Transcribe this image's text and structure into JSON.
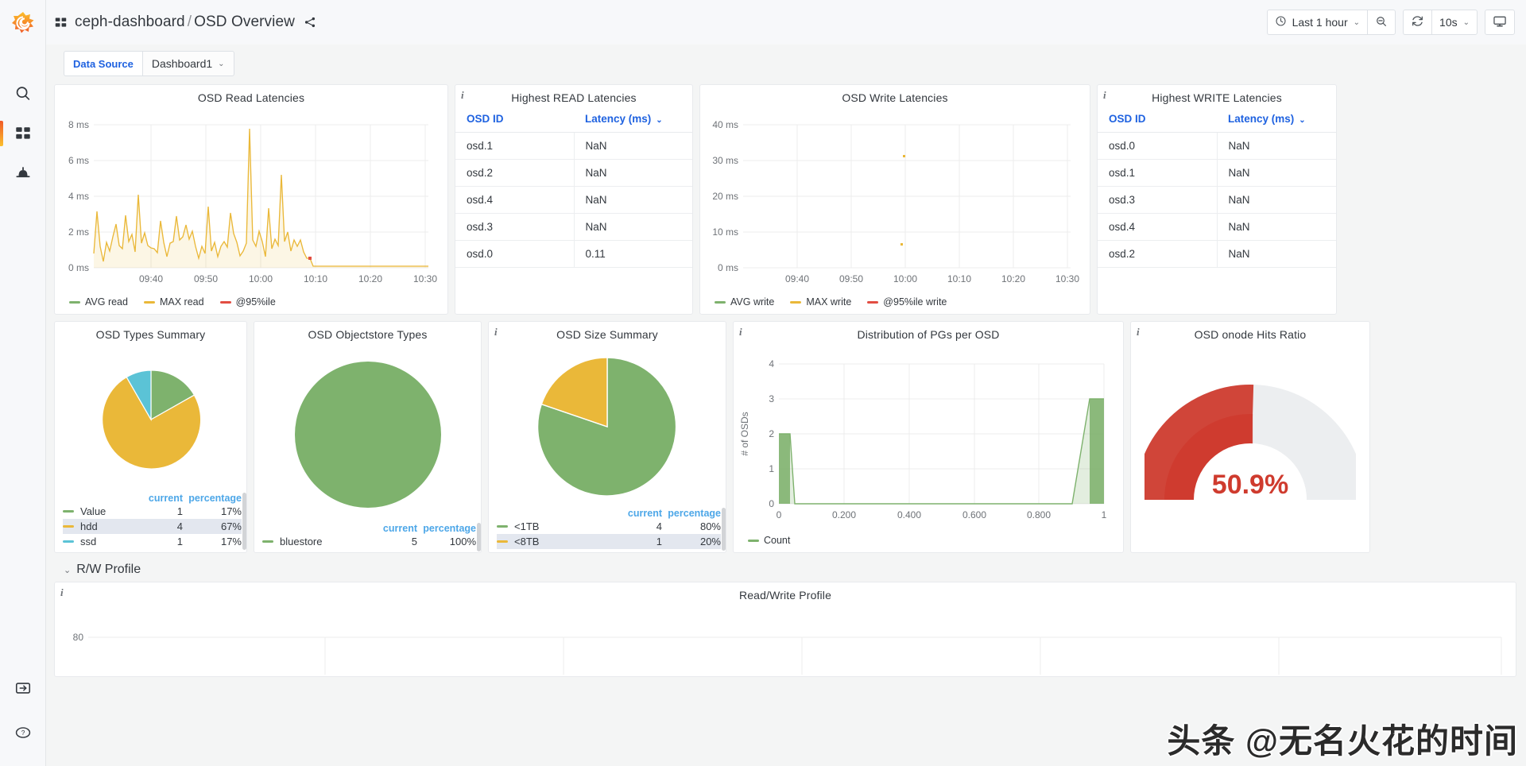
{
  "sidebar": {
    "logo": "grafana-logo",
    "items": [
      {
        "name": "search",
        "icon": "search-icon"
      },
      {
        "name": "dashboards",
        "icon": "dashboards-grid-icon",
        "active": true
      },
      {
        "name": "alerting",
        "icon": "bell-icon"
      }
    ],
    "bottom_items": [
      {
        "name": "sign-in",
        "icon": "sign-in-icon"
      },
      {
        "name": "help",
        "icon": "help-question-icon"
      }
    ]
  },
  "header": {
    "breadcrumb_root": "ceph-dashboard",
    "breadcrumb_sep": "/",
    "breadcrumb_current": "OSD Overview",
    "share_icon": "share-icon",
    "time_picker": {
      "icon": "clock-icon",
      "label": "Last 1 hour",
      "caret": "⌄"
    },
    "zoom_out": {
      "icon": "zoom-out-icon"
    },
    "refresh": {
      "icon": "refresh-icon"
    },
    "refresh_interval": {
      "label": "10s",
      "caret": "⌄"
    },
    "tv_mode": {
      "icon": "monitor-icon"
    }
  },
  "variables": {
    "datasource_label": "Data Source",
    "datasource_value": "Dashboard1",
    "caret": "⌄"
  },
  "colors": {
    "green": "#7eb26d",
    "yellow": "#eab839",
    "orange": "#e24d42",
    "cyan": "#5bc3d6",
    "blue_link": "#1f62e0",
    "legend_blue": "#4da7e8",
    "gauge_red": "#cf3b2e",
    "gauge_green": "#0fa21e",
    "gauge_track": "#eceef0"
  },
  "panels": {
    "osd_read_latencies": {
      "title": "OSD Read Latencies",
      "has_info": false,
      "legend": [
        {
          "label": "AVG read",
          "color": "#7eb26d"
        },
        {
          "label": "MAX read",
          "color": "#eab839"
        },
        {
          "label": "@95%ile",
          "color": "#e24d42"
        }
      ]
    },
    "highest_read_latencies": {
      "title": "Highest READ Latencies",
      "has_info": true,
      "columns": [
        "OSD ID",
        "Latency (ms)"
      ],
      "sort_caret": "⌄",
      "rows": [
        [
          "osd.1",
          "NaN"
        ],
        [
          "osd.2",
          "NaN"
        ],
        [
          "osd.4",
          "NaN"
        ],
        [
          "osd.3",
          "NaN"
        ],
        [
          "osd.0",
          "0.11"
        ]
      ]
    },
    "osd_write_latencies": {
      "title": "OSD Write Latencies",
      "has_info": false,
      "legend": [
        {
          "label": "AVG write",
          "color": "#7eb26d"
        },
        {
          "label": "MAX write",
          "color": "#eab839"
        },
        {
          "label": "@95%ile write",
          "color": "#e24d42"
        }
      ]
    },
    "highest_write_latencies": {
      "title": "Highest WRITE Latencies",
      "has_info": true,
      "columns": [
        "OSD ID",
        "Latency (ms)"
      ],
      "sort_caret": "⌄",
      "rows": [
        [
          "osd.0",
          "NaN"
        ],
        [
          "osd.1",
          "NaN"
        ],
        [
          "osd.3",
          "NaN"
        ],
        [
          "osd.4",
          "NaN"
        ],
        [
          "osd.2",
          "NaN"
        ]
      ]
    },
    "osd_types_summary": {
      "title": "OSD Types Summary",
      "has_info": false,
      "legend_headers": [
        "current",
        "percentage"
      ],
      "legend": [
        {
          "label": "Value",
          "color": "#7eb26d",
          "current": "1",
          "percentage": "17%",
          "highlight": false
        },
        {
          "label": "hdd",
          "color": "#eab839",
          "current": "4",
          "percentage": "67%",
          "highlight": true
        },
        {
          "label": "ssd",
          "color": "#5bc3d6",
          "current": "1",
          "percentage": "17%",
          "highlight": false
        }
      ]
    },
    "osd_objectstore_types": {
      "title": "OSD Objectstore Types",
      "has_info": false,
      "legend_headers": [
        "current",
        "percentage"
      ],
      "legend": [
        {
          "label": "bluestore",
          "color": "#7eb26d",
          "current": "5",
          "percentage": "100%",
          "highlight": false
        }
      ]
    },
    "osd_size_summary": {
      "title": "OSD Size Summary",
      "has_info": true,
      "legend_headers": [
        "current",
        "percentage"
      ],
      "legend": [
        {
          "label": "<1TB",
          "color": "#7eb26d",
          "current": "4",
          "percentage": "80%",
          "highlight": false
        },
        {
          "label": "<8TB",
          "color": "#eab839",
          "current": "1",
          "percentage": "20%",
          "highlight": true
        }
      ]
    },
    "distribution_pgs_per_osd": {
      "title": "Distribution of PGs per OSD",
      "has_info": true,
      "legend": [
        {
          "label": "Count",
          "color": "#7eb26d"
        }
      ]
    },
    "osd_onode_hits_ratio": {
      "title": "OSD onode Hits Ratio",
      "has_info": true,
      "value": "50.9%"
    },
    "rw_profile_section": {
      "title": "R/W Profile",
      "caret": "⌄"
    },
    "read_write_profile": {
      "title": "Read/Write Profile",
      "has_info": true,
      "y_tick": "80"
    }
  },
  "watermark": "头条 @无名火花的时间",
  "chart_data": [
    {
      "type": "line",
      "title": "OSD Read Latencies",
      "xlabel": "",
      "ylabel": "",
      "ylim": [
        0,
        8.8
      ],
      "yticks": [
        "0 ms",
        "2 ms",
        "4 ms",
        "6 ms",
        "8 ms"
      ],
      "ytickvals": [
        0,
        2,
        4,
        6,
        8
      ],
      "xticks": [
        "09:40",
        "09:50",
        "10:00",
        "10:10",
        "10:20",
        "10:30"
      ],
      "xtickvals": [
        0.175,
        0.355,
        0.535,
        0.715,
        0.89,
        1.0
      ],
      "grid": true,
      "legend_position": "bottom-left",
      "series": [
        {
          "name": "AVG read",
          "color": "#7eb26d",
          "values": []
        },
        {
          "name": "MAX read",
          "color": "#eab839",
          "values": [
            0.8,
            3.15,
            1.2,
            0.35,
            1.4,
            0.95,
            1.75,
            2.45,
            1.25,
            1.05,
            2.95,
            1.45,
            1.85,
            0.9,
            4.1,
            1.35,
            1.95,
            1.25,
            1.1,
            1.05,
            0.85,
            2.6,
            1.4,
            0.6,
            1.35,
            1.45,
            2.9,
            1.55,
            1.75,
            2.4,
            1.6,
            2.05,
            1.2,
            0.55,
            1.2,
            0.8,
            3.4,
            0.95,
            1.4,
            0.6,
            1.2,
            1.45,
            1.15,
            3.05,
            1.9,
            1.4,
            0.65,
            0.95,
            1.35,
            7.75,
            1.55,
            1.2,
            2.05,
            1.45,
            0.6,
            3.35,
            1.05,
            1.6,
            1.25,
            5.2,
            1.45,
            2.0,
            0.95,
            1.55,
            1.2,
            1.55,
            0.9,
            0.55,
            0.55,
            0.09,
            0.09,
            0.08,
            0.08,
            0.08,
            0.08,
            0.08,
            0.08,
            0.08,
            0.08,
            0.08,
            0.08,
            0.08,
            0.08,
            0.08,
            0.08,
            0.08,
            0.08,
            0.08,
            0.08,
            0.08
          ]
        },
        {
          "name": "@95%ile",
          "color": "#e24d42",
          "values": []
        }
      ]
    },
    {
      "type": "scatter",
      "title": "OSD Write Latencies",
      "xlabel": "",
      "ylabel": "",
      "ylim": [
        0,
        44
      ],
      "yticks": [
        "0 ms",
        "10 ms",
        "20 ms",
        "30 ms",
        "40 ms"
      ],
      "ytickvals": [
        0,
        10,
        20,
        30,
        40
      ],
      "xticks": [
        "09:40",
        "09:50",
        "10:00",
        "10:10",
        "10:20",
        "10:30"
      ],
      "xtickvals": [
        0.175,
        0.355,
        0.535,
        0.715,
        0.89,
        1.0
      ],
      "grid": true,
      "legend_position": "bottom-left",
      "points": [
        {
          "x": 0.525,
          "y": 31.8,
          "color": "#eab839"
        },
        {
          "x": 0.518,
          "y": 7.0,
          "color": "#eab839"
        }
      ],
      "series": [
        {
          "name": "AVG write",
          "color": "#7eb26d"
        },
        {
          "name": "MAX write",
          "color": "#eab839"
        },
        {
          "name": "@95%ile write",
          "color": "#e24d42"
        }
      ]
    },
    {
      "type": "pie",
      "title": "OSD Types Summary",
      "labels": [
        "Value",
        "hdd",
        "ssd"
      ],
      "values": [
        1,
        4,
        1
      ],
      "percentages": [
        "17%",
        "67%",
        "17%"
      ],
      "colors": [
        "#7eb26d",
        "#eab839",
        "#5bc3d6"
      ]
    },
    {
      "type": "pie",
      "title": "OSD Objectstore Types",
      "labels": [
        "bluestore"
      ],
      "values": [
        5
      ],
      "percentages": [
        "100%"
      ],
      "colors": [
        "#7eb26d"
      ]
    },
    {
      "type": "pie",
      "title": "OSD Size Summary",
      "labels": [
        "<1TB",
        "<8TB"
      ],
      "values": [
        4,
        1
      ],
      "percentages": [
        "80%",
        "20%"
      ],
      "colors": [
        "#7eb26d",
        "#eab839"
      ]
    },
    {
      "type": "area",
      "title": "Distribution of PGs per OSD",
      "xlabel": "",
      "ylabel": "# of OSDs",
      "ylim": [
        0,
        4
      ],
      "yticks": [
        "0",
        "1",
        "2",
        "3",
        "4"
      ],
      "ytickvals": [
        0,
        1,
        2,
        3,
        4
      ],
      "xticks": [
        "0",
        "0.200",
        "0.400",
        "0.600",
        "0.800",
        "1"
      ],
      "xtickvals": [
        0,
        0.2,
        0.4,
        0.6,
        0.8,
        1.0
      ],
      "grid": true,
      "legend_position": "bottom-left",
      "series": [
        {
          "name": "Count",
          "color": "#7eb26d",
          "x": [
            0,
            0.035,
            0.05,
            0.9,
            0.955,
            1.0
          ],
          "values": [
            2,
            2,
            0,
            0,
            3,
            3
          ]
        }
      ]
    },
    {
      "type": "gauge",
      "title": "OSD onode Hits Ratio",
      "value": 50.9,
      "display": "50.9%",
      "min": 0,
      "max": 100,
      "thresholds": [
        {
          "from": 0,
          "to": 90,
          "color": "#cf3b2e"
        },
        {
          "from": 90,
          "to": 100,
          "color": "#0fa21e"
        }
      ]
    }
  ]
}
